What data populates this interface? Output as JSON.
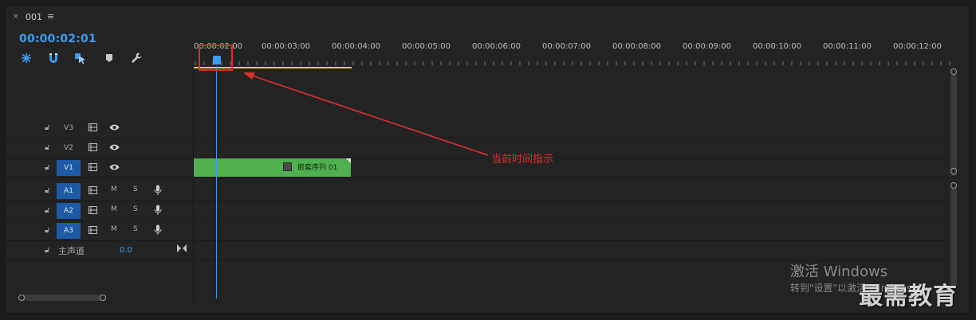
{
  "panel": {
    "tab": {
      "close_glyph": "×",
      "name": "001",
      "menu_glyph": "≡"
    },
    "timecode": "00:00:02:01",
    "toolbar": {
      "icons": [
        "nest-sequence-icon",
        "snap-magnet-icon",
        "linked-selection-icon",
        "add-marker-icon",
        "settings-wrench-icon"
      ]
    }
  },
  "ruler": {
    "labels": [
      "00:00:02:00",
      "00:00:03:00",
      "00:00:04:00",
      "00:00:05:00",
      "00:00:06:00",
      "00:00:07:00",
      "00:00:08:00",
      "00:00:09:00",
      "00:00:10:00",
      "00:00:11:00",
      "00:00:12:00"
    ]
  },
  "tracks": {
    "video": [
      {
        "name": "V3",
        "targeted": false
      },
      {
        "name": "V2",
        "targeted": false
      },
      {
        "name": "V1",
        "targeted": true
      }
    ],
    "audio": [
      {
        "name": "A1",
        "m": "M",
        "s": "S"
      },
      {
        "name": "A2",
        "m": "M",
        "s": "S"
      },
      {
        "name": "A3",
        "m": "M",
        "s": "S"
      }
    ],
    "master": {
      "label": "主声道",
      "value": "0.0"
    }
  },
  "clip": {
    "name": "嵌套序列 01",
    "color": "#4fb04f"
  },
  "annotation": {
    "text": "当前时间指示",
    "color": "#e03030"
  },
  "watermark": {
    "line1": "激活 Windows",
    "line2": "转到\"设置\"以激活 Windows。",
    "brand": "最需教育"
  },
  "colors": {
    "accent": "#3f9cf0",
    "work_area": "#e6d22b",
    "panel_bg": "#232323"
  }
}
